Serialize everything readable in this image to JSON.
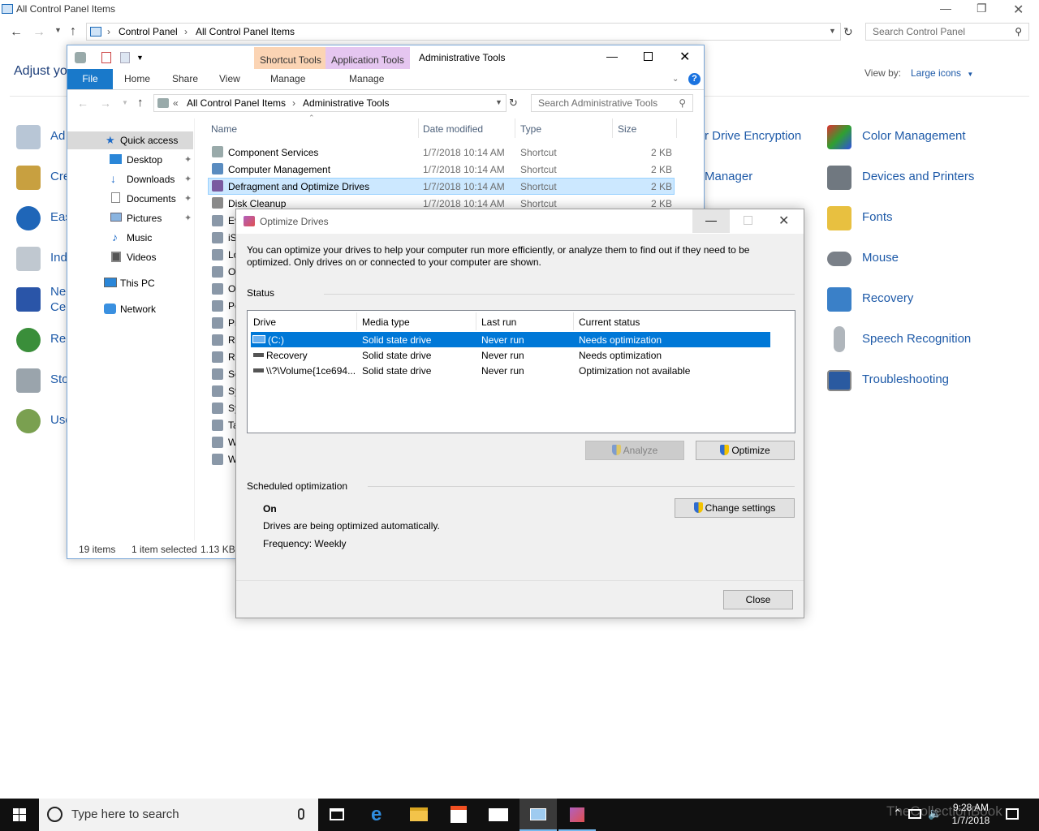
{
  "cp": {
    "title": "All Control Panel Items",
    "breadcrumb": [
      "Control Panel",
      "All Control Panel Items"
    ],
    "search_placeholder": "Search Control Panel",
    "adjust": "Adjust yo",
    "view_by_label": "View by:",
    "view_by_value": "Large icons",
    "left_items": [
      "Ad",
      "Cre",
      "Eas",
      "Ind",
      "Ne",
      "Cen",
      "Re",
      "Sto",
      "Use"
    ],
    "mid_items": [
      "r Drive Encryption",
      "Manager"
    ],
    "right_items": [
      "Color Management",
      "Devices and Printers",
      "Fonts",
      "Mouse",
      "Recovery",
      "Speech Recognition",
      "Troubleshooting"
    ]
  },
  "ex": {
    "ctx_shortcut": "Shortcut Tools",
    "ctx_app": "Application Tools",
    "title": "Administrative Tools",
    "tabs": [
      "File",
      "Home",
      "Share",
      "View",
      "Manage",
      "Manage"
    ],
    "breadcrumb": [
      "«",
      "All Control Panel Items",
      "Administrative Tools"
    ],
    "search_placeholder": "Search Administrative Tools",
    "nav": [
      "Quick access",
      "Desktop",
      "Downloads",
      "Documents",
      "Pictures",
      "Music",
      "Videos",
      "This PC",
      "Network"
    ],
    "headers": [
      "Name",
      "Date modified",
      "Type",
      "Size"
    ],
    "rows": [
      {
        "name": "Component Services",
        "date": "1/7/2018 10:14 AM",
        "type": "Shortcut",
        "size": "2 KB"
      },
      {
        "name": "Computer Management",
        "date": "1/7/2018 10:14 AM",
        "type": "Shortcut",
        "size": "2 KB"
      },
      {
        "name": "Defragment and Optimize Drives",
        "date": "1/7/2018 10:14 AM",
        "type": "Shortcut",
        "size": "2 KB"
      },
      {
        "name": "Disk Cleanup",
        "date": "1/7/2018 10:14 AM",
        "type": "Shortcut",
        "size": "2 KB"
      }
    ],
    "partial_rows": [
      "Ev",
      "iS",
      "Lo",
      "O",
      "O",
      "Pe",
      "Pr",
      "Re",
      "Re",
      "Se",
      "Sy",
      "Sy",
      "Ta",
      "W",
      "W"
    ],
    "status_items": "19 items",
    "status_selected": "1 item selected",
    "status_size": "1.13 KB"
  },
  "od": {
    "title": "Optimize Drives",
    "description": "You can optimize your drives to help your computer run more efficiently, or analyze them to find out if they need to be optimized. Only drives on or connected to your computer are shown.",
    "status_label": "Status",
    "columns": [
      "Drive",
      "Media type",
      "Last run",
      "Current status"
    ],
    "drives": [
      {
        "drive": "(C:)",
        "media": "Solid state drive",
        "last_run": "Never run",
        "status": "Needs optimization"
      },
      {
        "drive": "Recovery",
        "media": "Solid state drive",
        "last_run": "Never run",
        "status": "Needs optimization"
      },
      {
        "drive": "\\\\?\\Volume{1ce694...",
        "media": "Solid state drive",
        "last_run": "Never run",
        "status": "Optimization not available"
      }
    ],
    "analyze_label": "Analyze",
    "optimize_label": "Optimize",
    "scheduled_label": "Scheduled optimization",
    "sched_state": "On",
    "sched_desc": "Drives are being optimized automatically.",
    "sched_freq": "Frequency: Weekly",
    "change_settings_label": "Change settings",
    "close_label": "Close"
  },
  "taskbar": {
    "search_placeholder": "Type here to search",
    "time": "9:28 AM",
    "date": "1/7/2018",
    "watermark": "TheCollectionBook"
  },
  "colors": {
    "selection": "#0078d7",
    "explorer_selection": "#cce8ff",
    "accent": "#1e5aa8"
  }
}
